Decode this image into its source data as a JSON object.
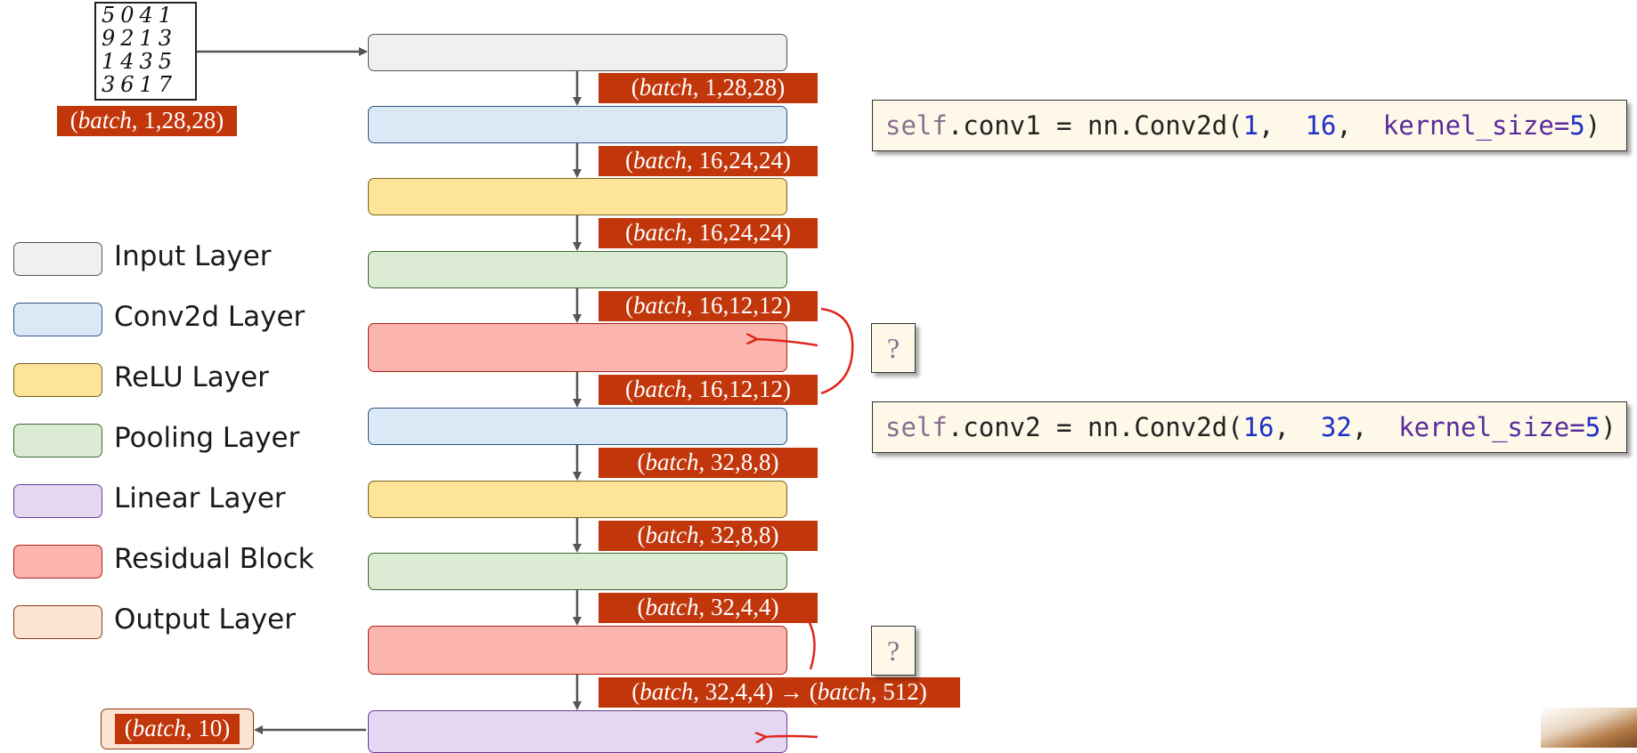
{
  "mnist_digits": [
    "5041",
    "9213",
    "1435",
    "3617"
  ],
  "input_shape": {
    "batch": "batch",
    "dims": ", 1,28,28)"
  },
  "shape_labels": [
    {
      "pre": "(",
      "batch": "batch",
      "post": ", 1,28,28)"
    },
    {
      "pre": "(",
      "batch": "batch",
      "post": ", 16,24,24)"
    },
    {
      "pre": "(",
      "batch": "batch",
      "post": ", 16,24,24)"
    },
    {
      "pre": "(",
      "batch": "batch",
      "post": ", 16,12,12)"
    },
    {
      "pre": "(",
      "batch": "batch",
      "post": ", 16,12,12)"
    },
    {
      "pre": "(",
      "batch": "batch",
      "post": ", 32,8,8)"
    },
    {
      "pre": "(",
      "batch": "batch",
      "post": ", 32,8,8)"
    },
    {
      "pre": "(",
      "batch": "batch",
      "post": ", 32,4,4)"
    },
    {
      "pre": "(",
      "batch": "batch",
      "post": ", 32,4,4) → (",
      "batch2": "batch",
      "post2": ", 512)"
    }
  ],
  "output_shape": {
    "pre": "(",
    "batch": "batch",
    "post": ", 10)"
  },
  "legend": [
    {
      "label": "Input Layer",
      "fill": "#f0f0f0",
      "border": "#555555"
    },
    {
      "label": "Conv2d Layer",
      "fill": "#dbe8f6",
      "border": "#2e5783"
    },
    {
      "label": "ReLU Layer",
      "fill": "#fde498",
      "border": "#7a6420"
    },
    {
      "label": "Pooling Layer",
      "fill": "#dcebd4",
      "border": "#3d6b2e"
    },
    {
      "label": "Linear Layer",
      "fill": "#e3d7f2",
      "border": "#6a3f99"
    },
    {
      "label": "Residual Block",
      "fill": "#fbb4ae",
      "border": "#b02418"
    },
    {
      "label": "Output Layer",
      "fill": "#fde3d2",
      "border": "#8a3a13"
    }
  ],
  "code": {
    "conv1": {
      "self": "self",
      "rest1": ".conv1 = nn.Conv2d(",
      "a": "1",
      "b": "16",
      "kw": "kernel_size",
      "eq": "=",
      "k": "5",
      "close": ")"
    },
    "conv2": {
      "self": "self",
      "rest1": ".conv2 = nn.Conv2d(",
      "a": "16",
      "b": "32",
      "kw": "kernel_size",
      "eq": "=",
      "k": "5",
      "close": ")"
    }
  },
  "question_mark": "?",
  "colors": {
    "label_bg": "#c1360a",
    "arrow": "#555555",
    "annotation": "#e0261b"
  }
}
